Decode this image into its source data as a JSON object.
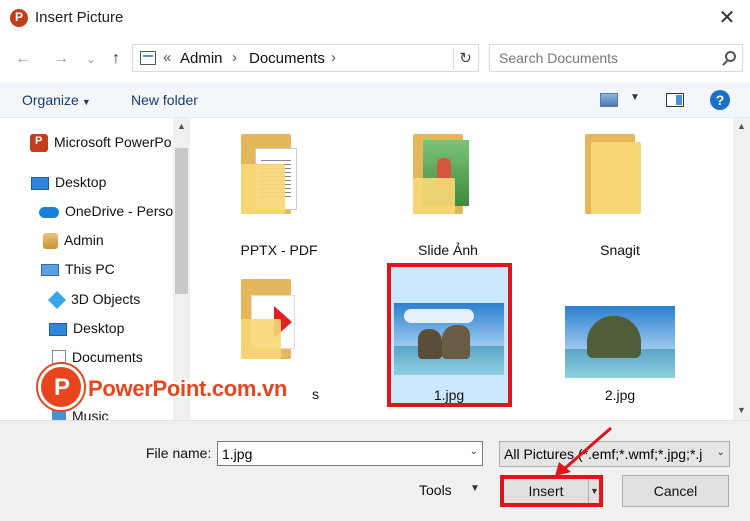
{
  "window": {
    "title": "Insert Picture",
    "close_glyph": "✕"
  },
  "nav_buttons": {
    "back": "←",
    "forward": "→",
    "dropdown": "⌄",
    "up": "↑"
  },
  "address": {
    "overflow": "«",
    "crumbs": [
      "Admin",
      "Documents"
    ],
    "separator": "›",
    "refresh_glyph": "↻"
  },
  "search": {
    "placeholder": "Search Documents"
  },
  "toolbar": {
    "organize_label": "Organize",
    "new_folder_label": "New folder",
    "help_glyph": "?"
  },
  "sidebar": {
    "items": [
      {
        "label": "Microsoft PowerPo",
        "icon": "powerpoint-icon"
      },
      {
        "label": "Desktop",
        "icon": "desktop-icon"
      },
      {
        "label": "OneDrive - Perso",
        "icon": "onedrive-icon"
      },
      {
        "label": "Admin",
        "icon": "user-folder-icon"
      },
      {
        "label": "This PC",
        "icon": "pc-icon"
      },
      {
        "label": "3D Objects",
        "icon": "3d-objects-icon"
      },
      {
        "label": "Desktop",
        "icon": "desktop-icon"
      },
      {
        "label": "Documents",
        "icon": "documents-icon"
      },
      {
        "label": "Music",
        "icon": "music-icon"
      }
    ]
  },
  "files": [
    {
      "name": "PPTX - PDF",
      "kind": "folder",
      "selected": false
    },
    {
      "name": "Slide Ảnh",
      "kind": "folder",
      "selected": false
    },
    {
      "name": "Snagit",
      "kind": "folder",
      "selected": false
    },
    {
      "name": "s",
      "kind": "folder",
      "selected": false
    },
    {
      "name": "1.jpg",
      "kind": "image",
      "selected": true
    },
    {
      "name": "2.jpg",
      "kind": "image",
      "selected": false
    }
  ],
  "watermark": {
    "text": "PowerPoint.com.vn",
    "logo_letter": "P"
  },
  "bottom": {
    "file_name_label": "File name:",
    "file_name_value": "1.jpg",
    "filter_value": "All Pictures (*.emf;*.wmf;*.jpg;*.j",
    "tools_label": "Tools",
    "insert_label": "Insert",
    "cancel_label": "Cancel"
  },
  "colors": {
    "accent": "#1a6fc9",
    "highlight_red": "#e1141b",
    "selection": "#cce8ff",
    "folder_yellow": "#f8d775",
    "brand_orange": "#e8451e"
  }
}
